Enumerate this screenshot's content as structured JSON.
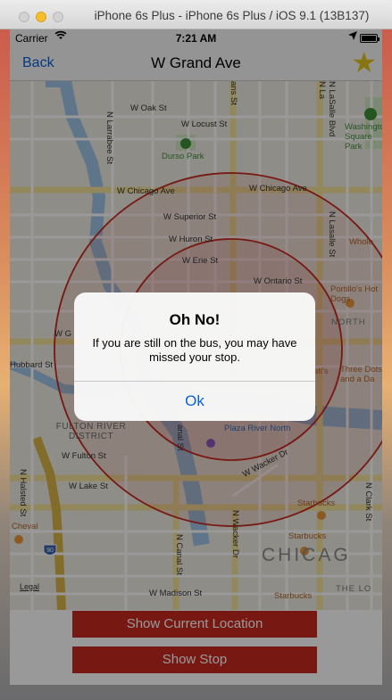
{
  "window": {
    "title": "iPhone 6s Plus - iPhone 6s Plus / iOS 9.1 (13B137)"
  },
  "status_bar": {
    "carrier": "Carrier",
    "time": "7:21 AM"
  },
  "nav": {
    "back_label": "Back",
    "title": "W Grand Ave",
    "star_icon": "star-icon",
    "star_color": "#e3c51e"
  },
  "map": {
    "streets": {
      "w_oak": "W Oak St",
      "n_larrabee": "N Larrabee St",
      "w_locust": "W Locust St",
      "durso_park": "Durso Park",
      "w_chicago_1": "W Chicago Ave",
      "w_chicago_2": "W Chicago Ave",
      "w_superior": "W Superior St",
      "w_huron": "W Huron St",
      "w_erie": "W Erie St",
      "w_ontario": "W Ontario St",
      "w_g": "W G",
      "hubbard": "Hubbard St",
      "fulton_district": "FULTON RIVER DISTRICT",
      "w_fulton": "W Fulton St",
      "w_lake": "W Lake St",
      "n_halsted": "N Halsted St",
      "cheval": "Cheval",
      "legal": "Legal",
      "w_madison": "W Madison St",
      "n_canal_1": "N Canal St",
      "n_canal_2": "anal St",
      "n_wacker_dr": "N Wacker Dr",
      "w_wacker": "W Wacker Dr",
      "plaza_river_north": "Plaza River North",
      "starbucks_1": "Starbucks",
      "starbucks_2": "Starbucks",
      "starbucks_3": "Starbucks",
      "chicago": "CHICAG",
      "the_lo": "THE LO",
      "n_clark": "N Clark St",
      "n_lasalle": "N LaSalle Blvd",
      "n_lasalle_st": "N Lasalle St",
      "n_la": "N La",
      "washington_square": "Washington Square Park",
      "whole": "Whole",
      "portillos": "Portillo's Hot Dogs",
      "north": "NORTH",
      "three_dots": "Three Dots and a Da",
      "atis": "ati's",
      "ans_st": "ans St",
      "interstate": "90"
    },
    "accent_water": "#9fc4e6",
    "circle_color": "#c7291e"
  },
  "buttons": {
    "show_current_location": "Show Current Location",
    "show_stop": "Show Stop",
    "color": "#c7291e"
  },
  "alert": {
    "title": "Oh No!",
    "message": "If you are still on the bus, you may have missed your stop.",
    "ok_label": "Ok"
  }
}
